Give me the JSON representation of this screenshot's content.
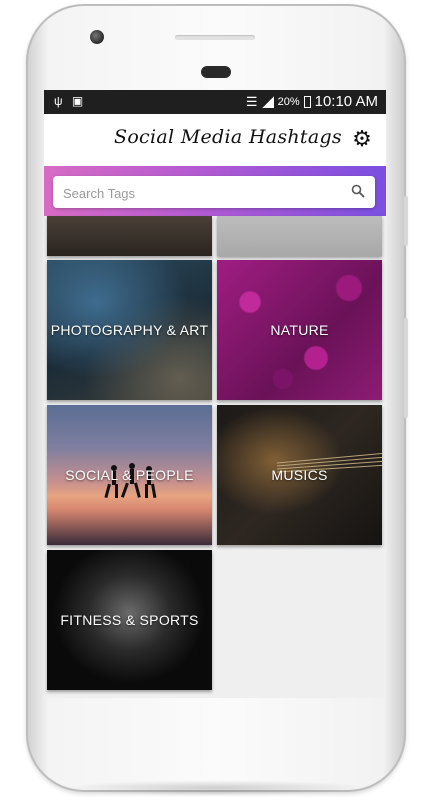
{
  "status_bar": {
    "usb_icon": "usb-icon",
    "no_sim_icon": "no-sim-icon",
    "wifi_icon": "wifi-icon",
    "signal_icon": "signal-icon",
    "battery_percent": "20%",
    "time": "10:10 AM"
  },
  "app_bar": {
    "title": "Social Media Hashtags",
    "settings_icon": "gear-icon"
  },
  "search": {
    "placeholder": "Search Tags",
    "icon": "search-icon"
  },
  "colors": {
    "search_band_start": "#d86bc4",
    "search_band_end": "#7b4fe0",
    "status_bar": "#1f1f1f"
  },
  "categories": [
    {
      "label": "PHOTOGRAPHY & ART"
    },
    {
      "label": "NATURE"
    },
    {
      "label": "SOCIAL & PEOPLE"
    },
    {
      "label": "MUSICS"
    },
    {
      "label": "FITNESS & SPORTS"
    }
  ]
}
